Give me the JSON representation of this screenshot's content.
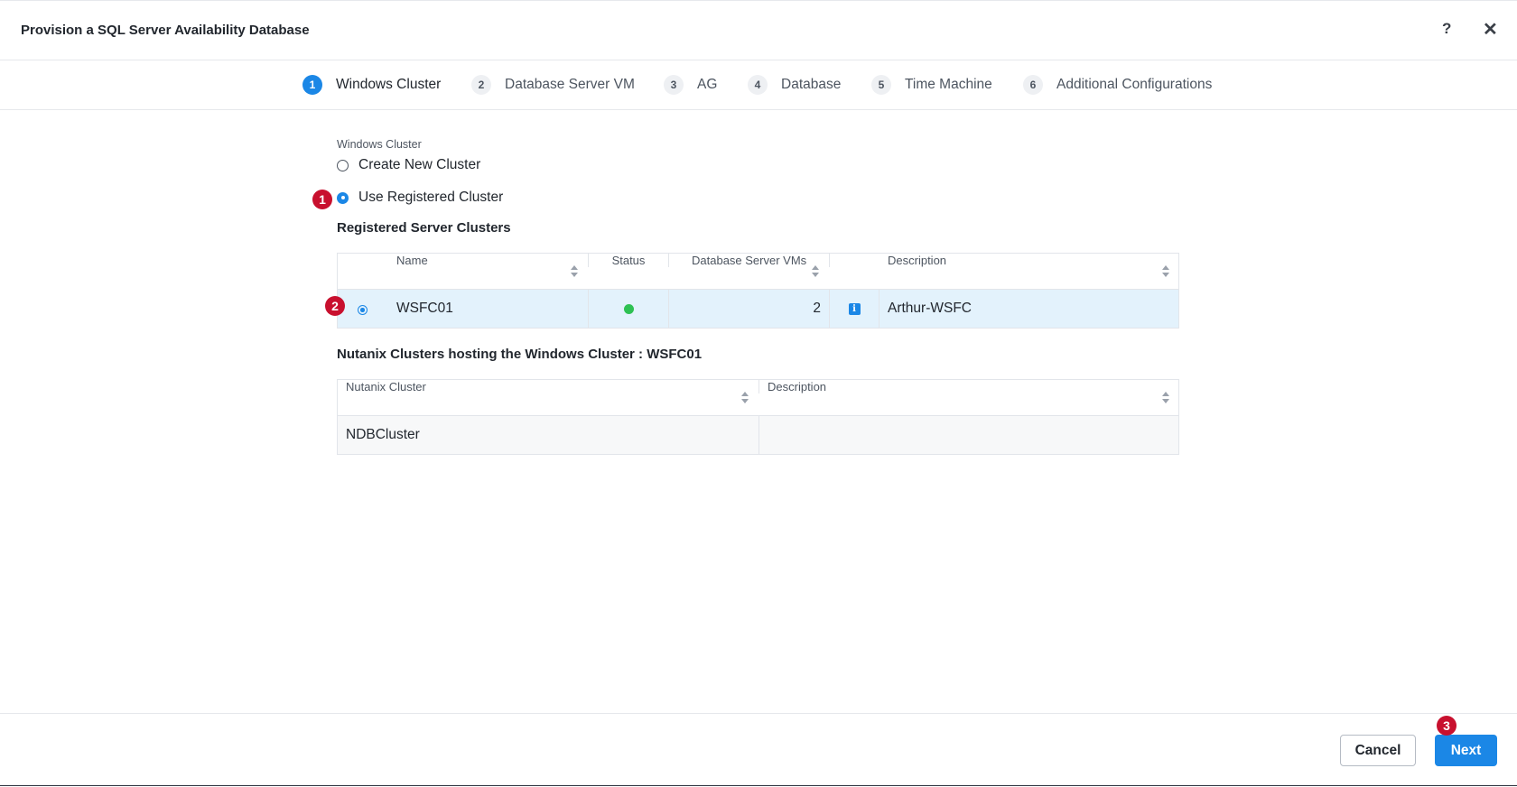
{
  "dialog": {
    "title": "Provision a SQL Server Availability Database",
    "help_label": "?",
    "close_label": "✕"
  },
  "steps": [
    {
      "num": "1",
      "label": "Windows Cluster",
      "active": true
    },
    {
      "num": "2",
      "label": "Database Server VM"
    },
    {
      "num": "3",
      "label": "AG"
    },
    {
      "num": "4",
      "label": "Database"
    },
    {
      "num": "5",
      "label": "Time Machine"
    },
    {
      "num": "6",
      "label": "Additional Configurations"
    }
  ],
  "windows_cluster": {
    "label": "Windows Cluster",
    "options": [
      {
        "label": "Create New Cluster",
        "selected": false
      },
      {
        "label": "Use Registered Cluster",
        "selected": true
      }
    ]
  },
  "registered_clusters": {
    "title": "Registered Server Clusters",
    "columns": [
      "Name",
      "Status",
      "Database Server VMs",
      "Description"
    ],
    "rows": [
      {
        "name": "WSFC01",
        "status": "online",
        "vm_count": "2",
        "description": "Arthur-WSFC",
        "selected": true
      }
    ]
  },
  "nutanix_clusters": {
    "title": "Nutanix Clusters hosting the Windows Cluster : WSFC01",
    "columns": [
      "Nutanix Cluster",
      "Description"
    ],
    "rows": [
      {
        "cluster": "NDBCluster",
        "description": ""
      }
    ]
  },
  "annotations": [
    "1",
    "2",
    "3"
  ],
  "footer": {
    "cancel_label": "Cancel",
    "next_label": "Next"
  },
  "colors": {
    "accent": "#1b87e6",
    "status_ok": "#2ec153",
    "annotation": "#c8102e",
    "selected_row": "#e3f2fc"
  }
}
